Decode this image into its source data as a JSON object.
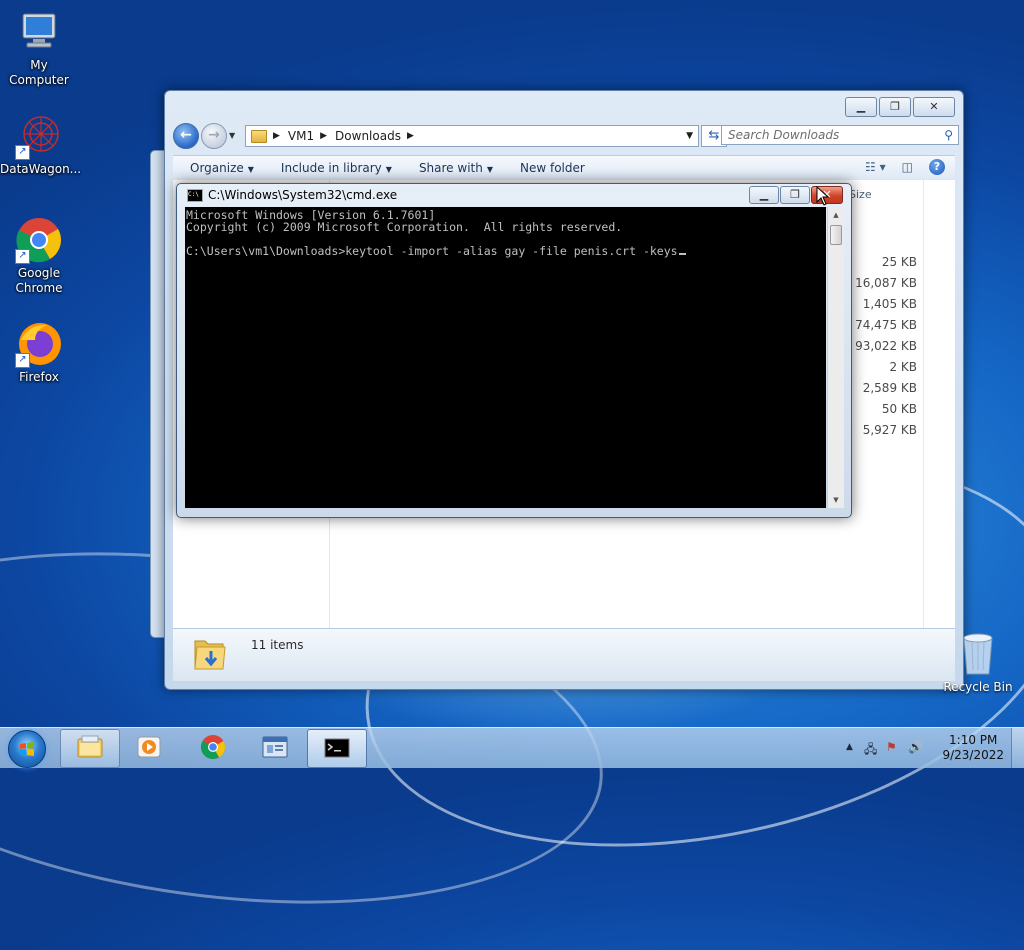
{
  "desktop": {
    "icons": [
      {
        "label": "My Computer"
      },
      {
        "label": "DataWagon..."
      },
      {
        "label": "Google Chrome"
      },
      {
        "label": "Firefox"
      }
    ],
    "recycle_bin": "Recycle Bin"
  },
  "explorer": {
    "breadcrumb": [
      "VM1",
      "Downloads"
    ],
    "search_placeholder": "Search Downloads",
    "commands": [
      "Organize",
      "Include in library",
      "Share with",
      "New folder"
    ],
    "column_header": "Size",
    "sizes": [
      "25 KB",
      "16,087 KB",
      "1,405 KB",
      "74,475 KB",
      "93,022 KB",
      "2 KB",
      "2,589 KB",
      "50 KB",
      "5,927 KB"
    ],
    "status": "11 items"
  },
  "cmd": {
    "title": "C:\\Windows\\System32\\cmd.exe",
    "lines": [
      "Microsoft Windows [Version 6.1.7601]",
      "Copyright (c) 2009 Microsoft Corporation.  All rights reserved.",
      "",
      "C:\\Users\\vm1\\Downloads>keytool -import -alias gay -file penis.crt -keys"
    ]
  },
  "taskbar": {
    "time": "1:10 PM",
    "date": "9/23/2022"
  },
  "icons": {
    "search": "magnifier-icon",
    "help": "help-icon",
    "refresh": "refresh-icon"
  }
}
